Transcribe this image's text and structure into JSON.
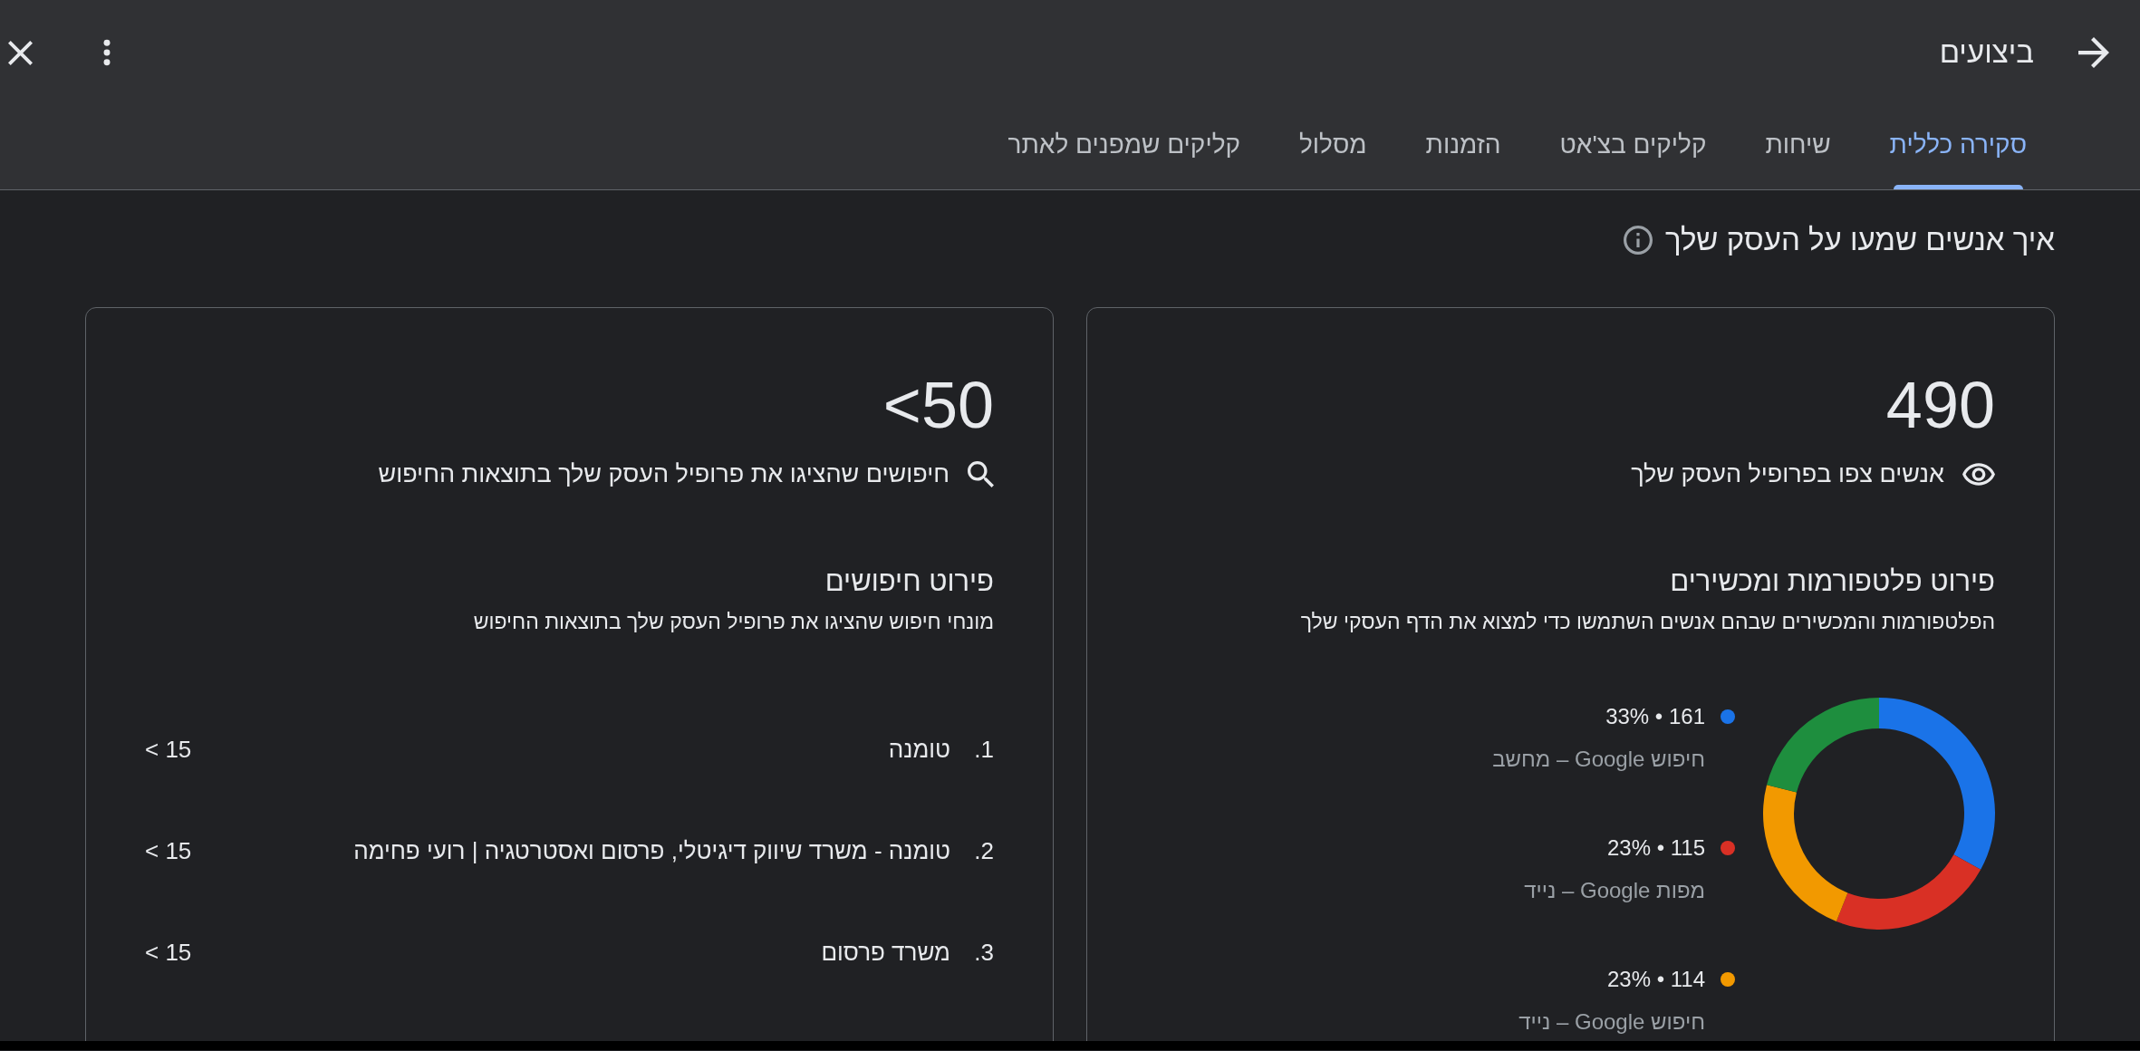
{
  "header": {
    "title": "ביצועים",
    "tabs": [
      {
        "label": "סקירה כללית",
        "selected": true
      },
      {
        "label": "שיחות",
        "selected": false
      },
      {
        "label": "קליקים בצ'אט",
        "selected": false
      },
      {
        "label": "הזמנות",
        "selected": false
      },
      {
        "label": "מסלול",
        "selected": false
      },
      {
        "label": "קליקים שמפנים לאתר",
        "selected": false
      }
    ]
  },
  "section": {
    "title": "איך אנשים שמעו על העסק שלך"
  },
  "profile_views": {
    "value": "490",
    "caption": "אנשים צפו בפרופיל העסק שלך",
    "breakdown_title": "פירוט פלטפורמות ומכשירים",
    "breakdown_subtitle": "הפלטפורמות והמכשירים שבהם אנשים השתמשו כדי למצוא את הדף העסקי שלך",
    "legend": [
      {
        "value": "161 • 33%",
        "label": "חיפוש Google – מחשב",
        "color": "#1a73e8"
      },
      {
        "value": "115 • 23%",
        "label": "מפות Google – נייד",
        "color": "#d93025"
      },
      {
        "value": "114 • 23%",
        "label": "חיפוש Google – נייד",
        "color": "#f29900"
      }
    ],
    "chart_data": {
      "type": "donut",
      "values": [
        33,
        23,
        23,
        21
      ],
      "colors": [
        "#1a73e8",
        "#d93025",
        "#f29900",
        "#1e8e3e"
      ]
    }
  },
  "searches": {
    "value": "<50",
    "caption": "חיפושים שהציגו את פרופיל העסק שלך בתוצאות החיפוש",
    "breakdown_title": "פירוט חיפושים",
    "breakdown_subtitle": "מונחי חיפוש שהציגו את פרופיל העסק שלך בתוצאות החיפוש",
    "terms": [
      {
        "rank": "1.",
        "term": "טומנה",
        "count": "< 15"
      },
      {
        "rank": "2.",
        "term": "טומנה - משרד שיווק דיגיטלי, פרסום ואסטרטגיה | רועי פחימה",
        "count": "< 15"
      },
      {
        "rank": "3.",
        "term": "משרד פרסום",
        "count": "< 15"
      }
    ]
  }
}
